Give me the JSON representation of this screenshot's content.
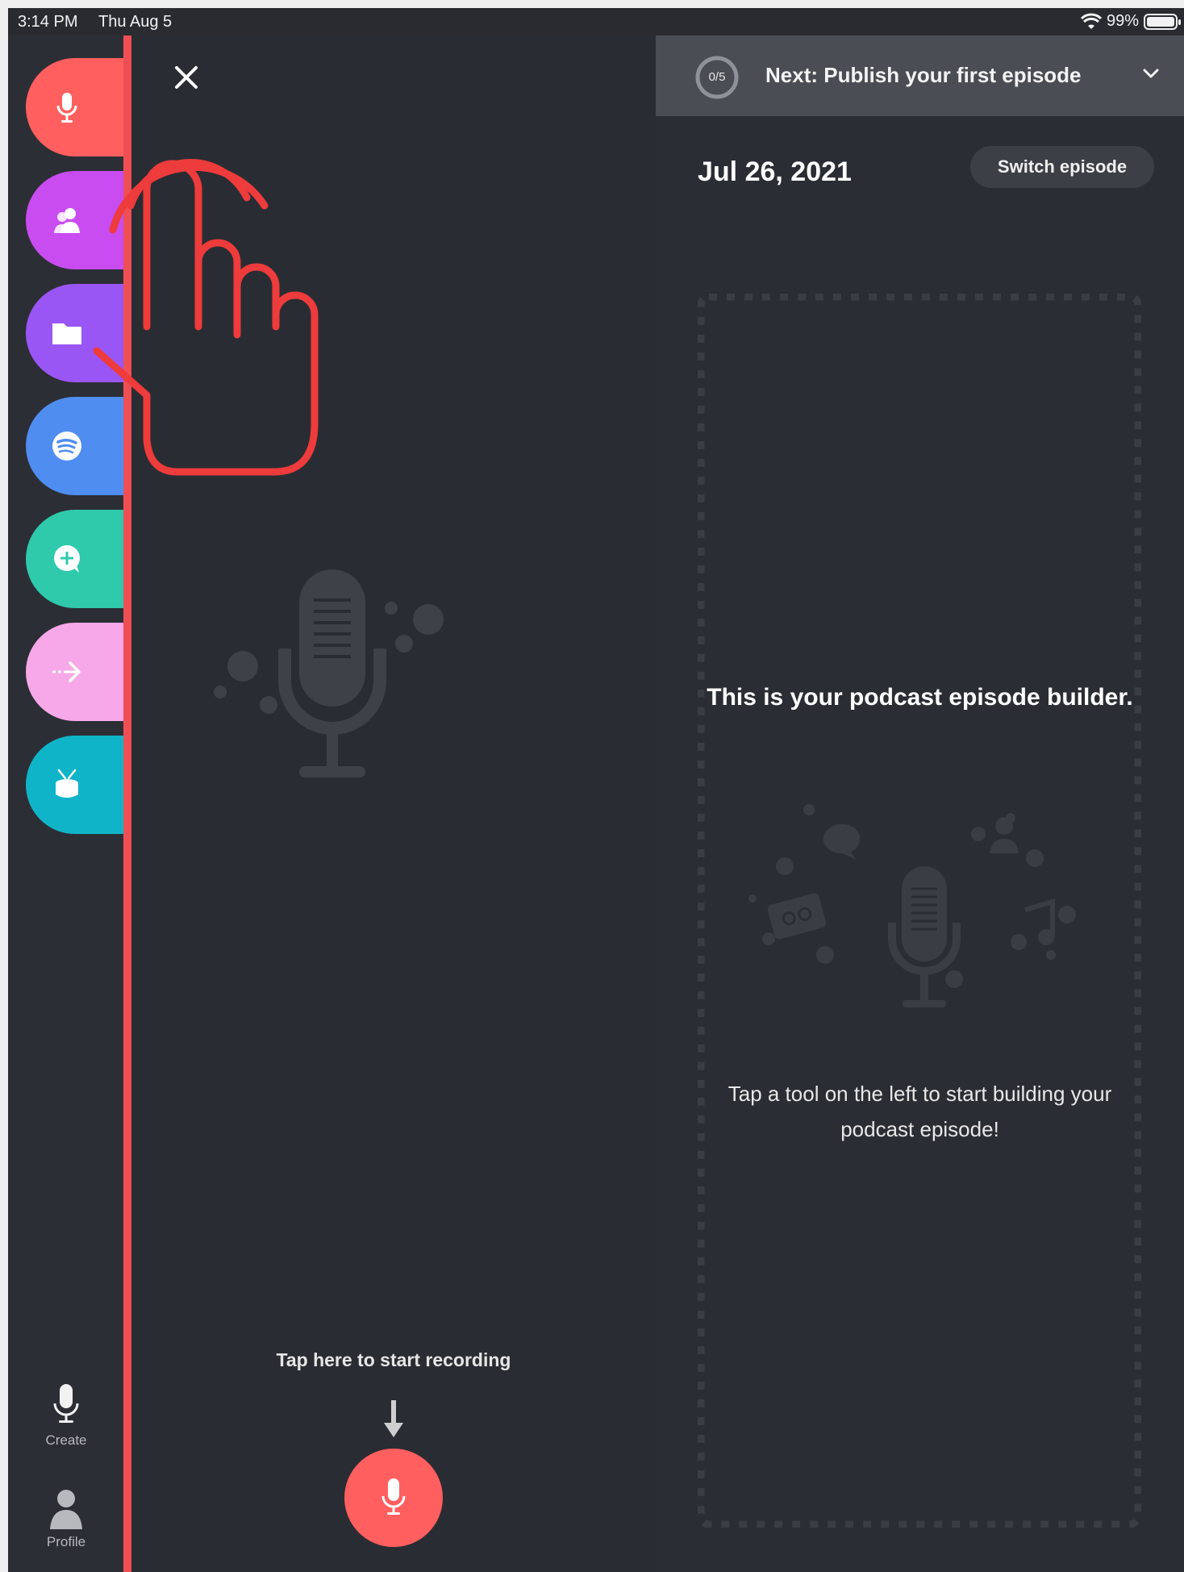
{
  "status_bar": {
    "time": "3:14 PM",
    "date": "Thu Aug 5",
    "battery": "99%"
  },
  "sidebar": {
    "tools": [
      {
        "name": "record",
        "icon": "microphone-icon",
        "color": "#ff5f5f"
      },
      {
        "name": "interview",
        "icon": "people-icon",
        "color": "#c84cf0"
      },
      {
        "name": "library",
        "icon": "folder-icon",
        "color": "#9a55f5"
      },
      {
        "name": "spotify",
        "icon": "spotify-icon",
        "color": "#4f8df0"
      },
      {
        "name": "messages",
        "icon": "message-plus-icon",
        "color": "#2fc9ac"
      },
      {
        "name": "transitions",
        "icon": "arrow-right-icon",
        "color": "#f6a8e8"
      },
      {
        "name": "music",
        "icon": "drum-icon",
        "color": "#10b4c9"
      }
    ],
    "nav": {
      "create_label": "Create",
      "profile_label": "Profile"
    }
  },
  "recorder": {
    "hint": "Tap here to start recording"
  },
  "builder": {
    "progress": "0/5",
    "next_step": "Next: Publish your first episode",
    "episode_date": "Jul 26, 2021",
    "switch_label": "Switch episode",
    "title": "This is your podcast episode builder.",
    "hint": "Tap a tool on the left to start building your podcast episode!"
  },
  "colors": {
    "accent": "#ff5f5f",
    "divider": "#ee4f55",
    "panel": "#2a2c33",
    "next_bar": "#4a4d54"
  }
}
